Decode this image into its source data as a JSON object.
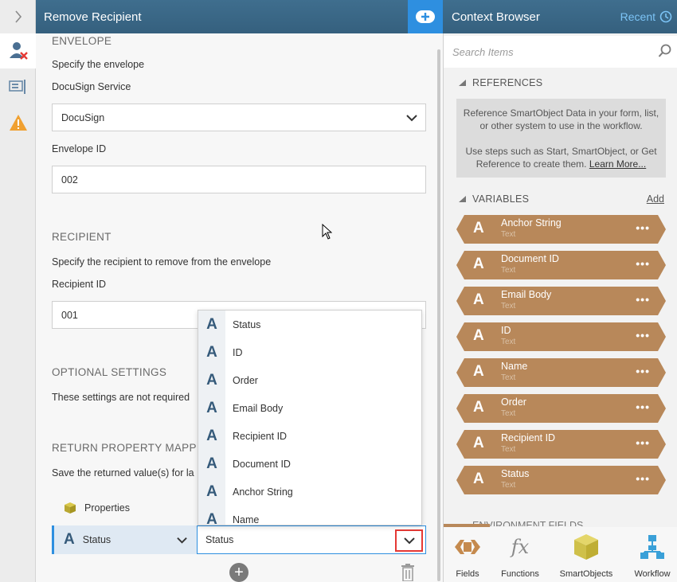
{
  "app": {
    "title": "Remove Recipient",
    "context_title": "Context Browser",
    "recent_label": "Recent"
  },
  "envelope": {
    "section_title": "ENVELOPE",
    "description": "Specify the envelope",
    "service_label": "DocuSign Service",
    "service_value": "DocuSign",
    "envelope_id_label": "Envelope ID",
    "envelope_id_value": "002"
  },
  "recipient": {
    "section_title": "RECIPIENT",
    "description": "Specify the recipient to remove from the envelope",
    "recipient_id_label": "Recipient ID",
    "recipient_id_value": "001"
  },
  "optional": {
    "section_title": "OPTIONAL SETTINGS",
    "description": "These settings are not required"
  },
  "return_mapping": {
    "section_title": "RETURN PROPERTY MAPPIN",
    "description": "Save the returned value(s) for la",
    "properties_label": "Properties",
    "status_label": "Status",
    "status_value": "Status"
  },
  "dropdown": {
    "items": [
      {
        "icon": "A",
        "label": "Status"
      },
      {
        "icon": "A",
        "label": "ID"
      },
      {
        "icon": "A",
        "label": "Order"
      },
      {
        "icon": "A",
        "label": "Email Body"
      },
      {
        "icon": "A",
        "label": "Recipient ID"
      },
      {
        "icon": "A",
        "label": "Document ID"
      },
      {
        "icon": "A",
        "label": "Anchor String"
      },
      {
        "icon": "A",
        "label": "Name"
      }
    ]
  },
  "context": {
    "search_placeholder": "Search Items",
    "references_title": "REFERENCES",
    "references_text1": "Reference SmartObject Data in your form, list, or other system to use in the workflow.",
    "references_text2": "Use steps such as Start, SmartObject, or Get Reference to create them.",
    "learn_more": "Learn More...",
    "variables_title": "VARIABLES",
    "add_label": "Add",
    "variables": [
      {
        "icon": "A",
        "name": "Anchor String",
        "type": "Text"
      },
      {
        "icon": "A",
        "name": "Document ID",
        "type": "Text"
      },
      {
        "icon": "A",
        "name": "Email Body",
        "type": "Text"
      },
      {
        "icon": "A",
        "name": "ID",
        "type": "Text"
      },
      {
        "icon": "A",
        "name": "Name",
        "type": "Text"
      },
      {
        "icon": "A",
        "name": "Order",
        "type": "Text"
      },
      {
        "icon": "A",
        "name": "Recipient ID",
        "type": "Text"
      },
      {
        "icon": "A",
        "name": "Status",
        "type": "Text"
      }
    ],
    "more_glyph": "•••",
    "environment_title": "ENVIRONMENT FIELDS"
  },
  "bottom_tabs": {
    "fields": "Fields",
    "fx_glyph": "fx",
    "functions": "Functions",
    "smartobjects": "SmartObjects",
    "workflow": "Workflow"
  },
  "colors": {
    "header": "#3a6785",
    "accent": "#2e8fe0",
    "variable": "#b8885a",
    "warning": "#f0a030",
    "highlight": "#e53935"
  },
  "icons": [
    "chevron-right-icon",
    "remove-user-icon",
    "form-icon",
    "warning-icon",
    "add-icon",
    "clock-icon",
    "search-icon",
    "cube-icon",
    "trash-icon",
    "workflow-icon"
  ]
}
